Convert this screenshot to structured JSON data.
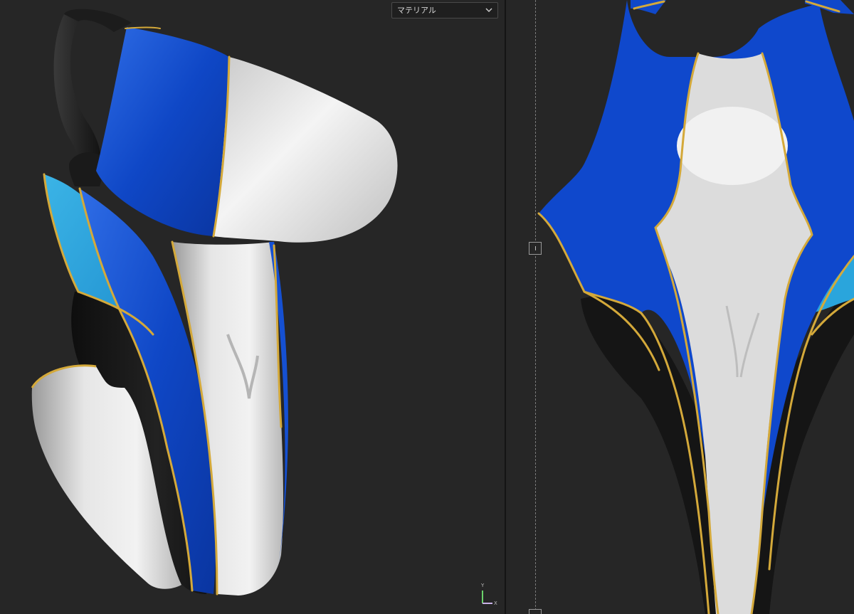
{
  "viewport3d": {
    "render_mode": {
      "selected": "マテリアル"
    },
    "axis_gizmo": {
      "y_label": "Y",
      "x_label": "X"
    }
  },
  "colors": {
    "background": "#262626",
    "royal_blue": "#1048c9",
    "light_blue": "#2aa5dc",
    "white_fabric": "#e2e2e2",
    "black_fabric": "#161616",
    "gold_piping": "#d4a93a"
  },
  "icons": {
    "dropdown": "chevron-down-icon",
    "gizmo": "axis-gizmo-icon",
    "center_handle": "axis-handle-icon"
  }
}
